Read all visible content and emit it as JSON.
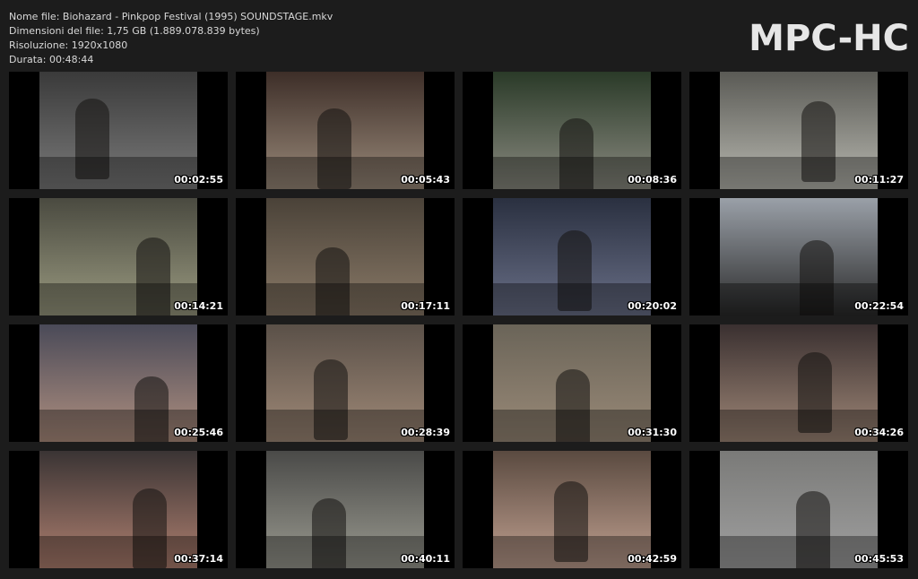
{
  "info": {
    "filename_line": "Nome file: Biohazard - Pinkpop Festival (1995) SOUNDSTAGE.mkv",
    "filesize_line": "Dimensioni del file: 1,75 GB (1.889.078.839 bytes)",
    "resolution_line": "Risoluzione: 1920x1080",
    "duration_line": "Durata: 00:48:44"
  },
  "brand": "MPC-HC",
  "thumbnails": [
    {
      "timestamp": "00:02:55",
      "bg": "#3a3a3a",
      "accent": "#7a7a7a"
    },
    {
      "timestamp": "00:05:43",
      "bg": "#3d2e28",
      "accent": "#9a8a7a"
    },
    {
      "timestamp": "00:08:36",
      "bg": "#2a3a28",
      "accent": "#8a8a80"
    },
    {
      "timestamp": "00:11:27",
      "bg": "#5a5a55",
      "accent": "#b8b8b0"
    },
    {
      "timestamp": "00:14:21",
      "bg": "#4a4a40",
      "accent": "#9a9a80"
    },
    {
      "timestamp": "00:17:11",
      "bg": "#4a4238",
      "accent": "#8a7a68"
    },
    {
      "timestamp": "00:20:02",
      "bg": "#2a3040",
      "accent": "#6a7088"
    },
    {
      "timestamp": "00:22:54",
      "bg": "#9aa0a8",
      "accent": "#2a2a2a"
    },
    {
      "timestamp": "00:25:46",
      "bg": "#4a4a58",
      "accent": "#b09080"
    },
    {
      "timestamp": "00:28:39",
      "bg": "#5a5048",
      "accent": "#a08a78"
    },
    {
      "timestamp": "00:31:30",
      "bg": "#6a6458",
      "accent": "#9a8a78"
    },
    {
      "timestamp": "00:34:26",
      "bg": "#3a3030",
      "accent": "#a08878"
    },
    {
      "timestamp": "00:37:14",
      "bg": "#3a3434",
      "accent": "#b08070"
    },
    {
      "timestamp": "00:40:11",
      "bg": "#4a4a48",
      "accent": "#9a9a90"
    },
    {
      "timestamp": "00:42:59",
      "bg": "#5a4a40",
      "accent": "#c0a090"
    },
    {
      "timestamp": "00:45:53",
      "bg": "#7a7a78",
      "accent": "#a0a0a0"
    }
  ]
}
